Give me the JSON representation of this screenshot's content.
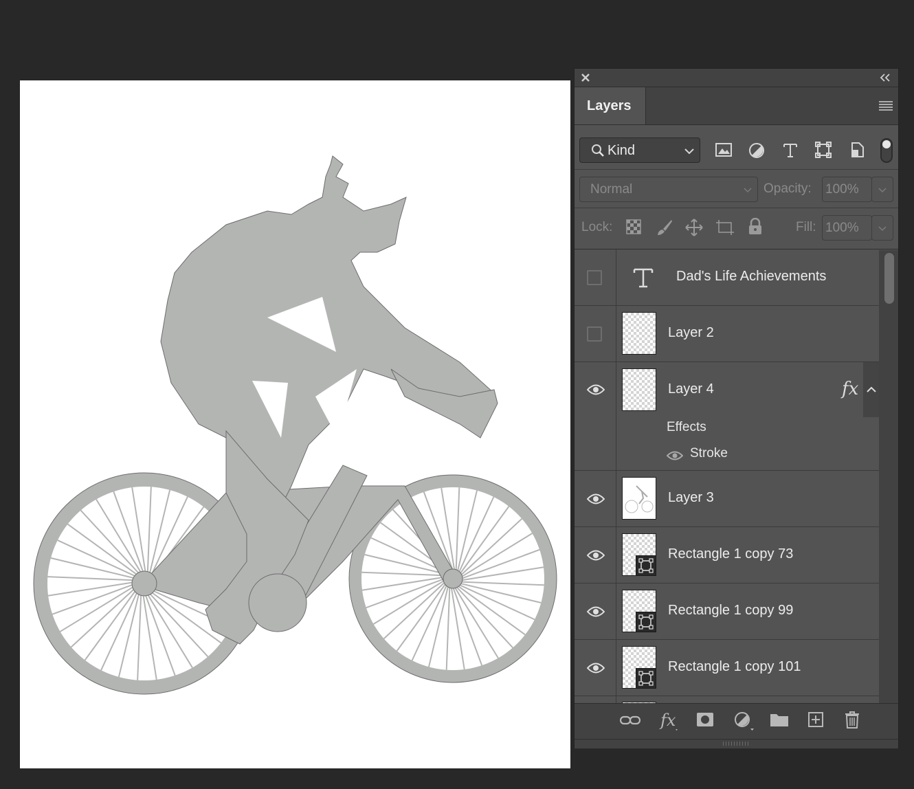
{
  "panel": {
    "tab_label": "Layers",
    "filter": {
      "label": "Kind"
    },
    "blend_mode": "Normal",
    "opacity_label": "Opacity:",
    "opacity_value": "100%",
    "lock_label": "Lock:",
    "fill_label": "Fill:",
    "fill_value": "100%"
  },
  "layers": [
    {
      "name": "Dad's Life Achievements",
      "type": "text",
      "visible": false
    },
    {
      "name": "Layer 2",
      "type": "pixel",
      "visible": false
    },
    {
      "name": "Layer 4",
      "type": "pixel",
      "visible": true,
      "fx": "fx",
      "effects_label": "Effects",
      "effect_name": "Stroke"
    },
    {
      "name": "Layer 3",
      "type": "pixel",
      "visible": true
    },
    {
      "name": "Rectangle 1 copy 73",
      "type": "shape",
      "visible": true
    },
    {
      "name": "Rectangle 1 copy 99",
      "type": "shape",
      "visible": true
    },
    {
      "name": "Rectangle 1 copy 101",
      "type": "shape",
      "visible": true
    }
  ],
  "colors": {
    "app_bg": "#282828",
    "panel_bg": "#535353",
    "silhouette": "#b3b5b3"
  }
}
